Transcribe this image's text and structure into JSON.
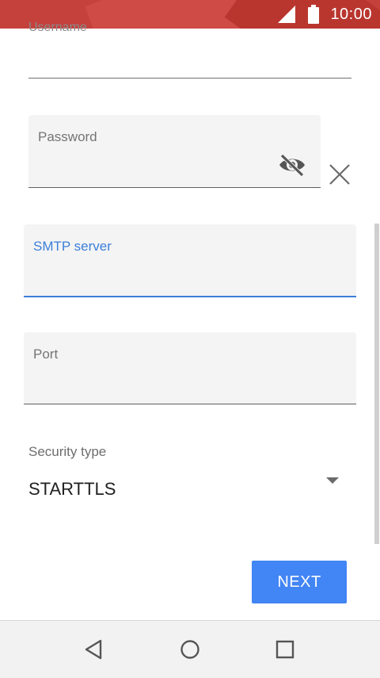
{
  "status_bar": {
    "time": "10:00",
    "icons": [
      "signal-icon",
      "battery-icon"
    ],
    "color": "#c5413c"
  },
  "form": {
    "username": {
      "label": "Username"
    },
    "password": {
      "label": "Password",
      "icons": [
        "visibility-off-icon",
        "close-icon"
      ]
    },
    "smtp_server": {
      "label": "SMTP server",
      "focused": true
    },
    "port": {
      "label": "Port"
    },
    "security_type": {
      "label": "Security type",
      "value": "STARTTLS"
    }
  },
  "actions": {
    "next_label": "NEXT",
    "accent": "#4285f4"
  },
  "nav_bar": {
    "buttons": [
      "back-icon",
      "home-icon",
      "recents-icon"
    ]
  }
}
